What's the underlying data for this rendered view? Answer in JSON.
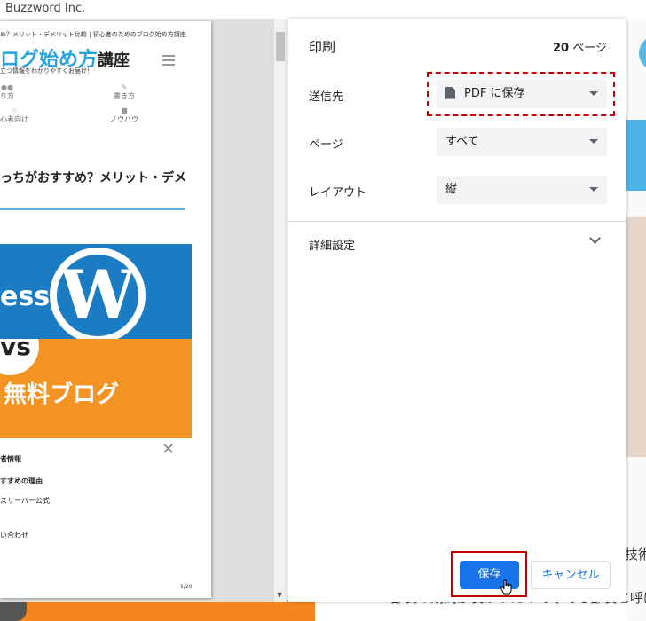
{
  "background": {
    "brand": "Buzzword Inc.",
    "text_line1": "技術",
    "text_line2": "部長の期間が長かったので今でも部長と呼ば"
  },
  "preview": {
    "breadcrumb": "め？メリット・デメリット比較 | 初心者のためのブログ始め方講座",
    "logo_main": "ログ始め方",
    "logo_suffix": "講座",
    "tagline": "立つ情報をわかりやすくお届け！",
    "nav": [
      "り方",
      "書き方",
      "心者向け",
      "ノウハウ"
    ],
    "article_title": "っちがおすすめ？メリット・デメ",
    "banner_top_text": "ess",
    "banner_wp": "W",
    "banner_vs": "vs",
    "banner_free": "無料ブログ",
    "close_glyph": "✕",
    "list": [
      "者情報",
      "すすめの理由",
      "スサーバー公式",
      "い合わせ"
    ],
    "page_number": "1/20"
  },
  "dialog": {
    "title": "印刷",
    "page_count": "20",
    "page_unit": "ページ",
    "destination_label": "送信先",
    "destination_value": "PDF に保存",
    "pages_label": "ページ",
    "pages_value": "すべて",
    "layout_label": "レイアウト",
    "layout_value": "縦",
    "more_settings": "詳細設定",
    "save_button": "保存",
    "cancel_button": "キャンセル"
  },
  "colors": {
    "accent": "#1a73e8",
    "highlight": "#c00000"
  }
}
